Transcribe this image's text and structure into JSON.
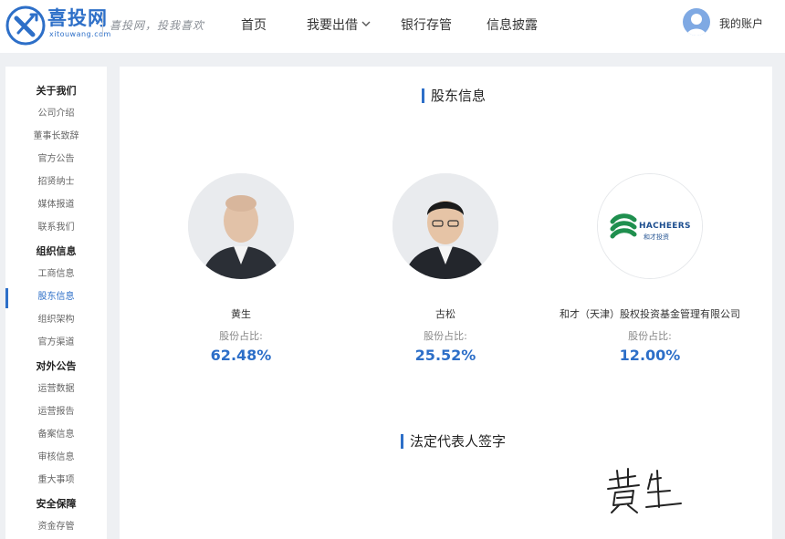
{
  "header": {
    "brand_name": "喜投网",
    "brand_domain": "xitouwang.com",
    "slogan": "喜投网，投我喜欢",
    "nav": [
      "首页",
      "我要出借",
      "银行存管",
      "信息披露"
    ],
    "account_label": "我的账户"
  },
  "sidebar": {
    "items": [
      {
        "label": "关于我们",
        "type": "section"
      },
      {
        "label": "公司介绍",
        "type": "item"
      },
      {
        "label": "董事长致辞",
        "type": "item"
      },
      {
        "label": "官方公告",
        "type": "item"
      },
      {
        "label": "招贤纳士",
        "type": "item"
      },
      {
        "label": "媒体报道",
        "type": "item"
      },
      {
        "label": "联系我们",
        "type": "item"
      },
      {
        "label": "组织信息",
        "type": "section"
      },
      {
        "label": "工商信息",
        "type": "item"
      },
      {
        "label": "股东信息",
        "type": "item",
        "active": true
      },
      {
        "label": "组织架构",
        "type": "item"
      },
      {
        "label": "官方渠道",
        "type": "item"
      },
      {
        "label": "对外公告",
        "type": "section"
      },
      {
        "label": "运营数据",
        "type": "item"
      },
      {
        "label": "运营报告",
        "type": "item"
      },
      {
        "label": "备案信息",
        "type": "item"
      },
      {
        "label": "审核信息",
        "type": "item"
      },
      {
        "label": "重大事项",
        "type": "item"
      },
      {
        "label": "安全保障",
        "type": "section"
      },
      {
        "label": "资金存管",
        "type": "item"
      }
    ]
  },
  "main": {
    "shareholder_title": "股东信息",
    "shareholders": [
      {
        "name": "黄生",
        "share_label": "股份占比:",
        "share": "62.48%"
      },
      {
        "name": "古松",
        "share_label": "股份占比:",
        "share": "25.52%"
      },
      {
        "name": "和才（天津）股权投资基金管理有限公司",
        "share_label": "股份占比:",
        "share": "12.00%",
        "logo_text": "HACHEERS",
        "logo_subtext": "和才投资"
      }
    ],
    "legal_rep_title": "法定代表人签字",
    "signature_text": "黄生"
  },
  "colors": {
    "accent": "#2d6fc8",
    "page_bg": "#eef0f3",
    "logo_green": "#1f8f4e"
  }
}
